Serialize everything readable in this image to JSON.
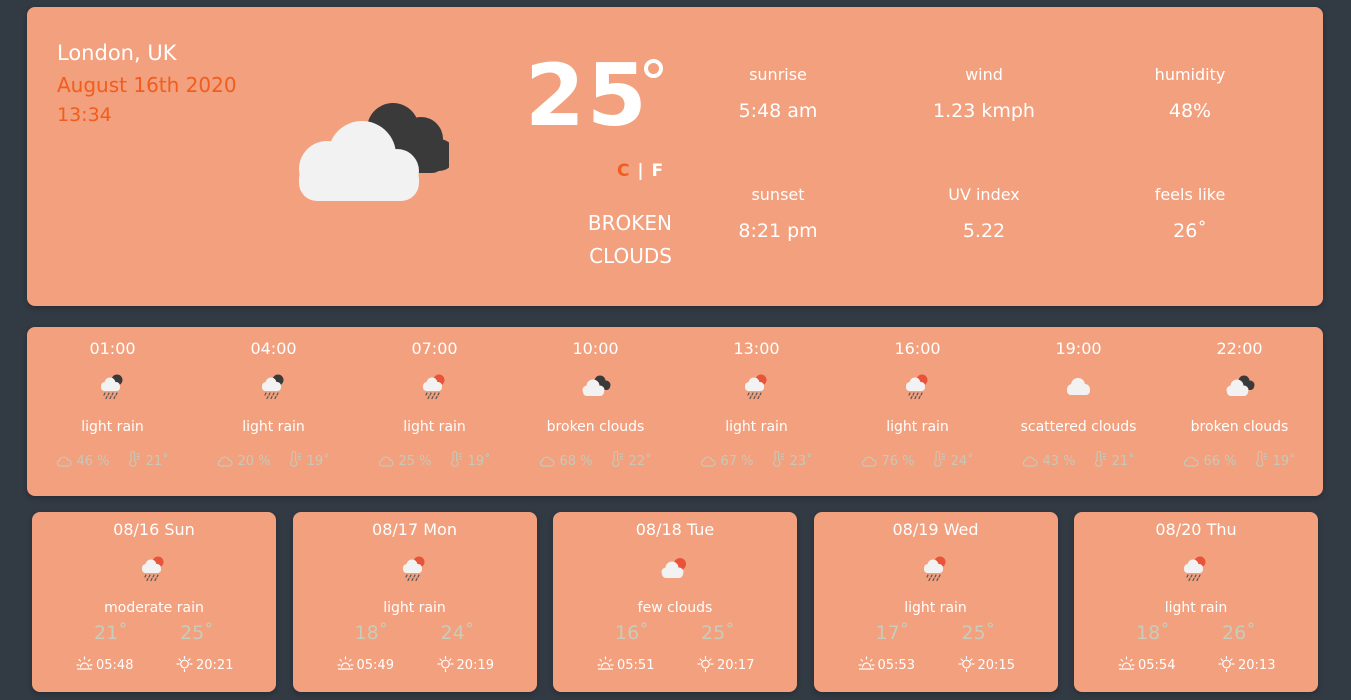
{
  "current": {
    "location": "London, UK",
    "date": "August 16th 2020",
    "time": "13:34",
    "temperature": "25",
    "unit_c": "C",
    "unit_separator": "|",
    "unit_f": "F",
    "description_line1": "broken",
    "description_line2": "clouds",
    "icon": "broken-clouds-icon",
    "stats": {
      "sunrise": {
        "label": "sunrise",
        "value": "5:48 am"
      },
      "wind": {
        "label": "wind",
        "value": "1.23 kmph"
      },
      "humidity": {
        "label": "humidity",
        "value": "48%"
      },
      "sunset": {
        "label": "sunset",
        "value": "8:21 pm"
      },
      "uv": {
        "label": "UV index",
        "value": "5.22"
      },
      "feels_like": {
        "label": "feels like",
        "value": "26˚"
      }
    }
  },
  "hourly": [
    {
      "time": "01:00",
      "icon": "rain-night-icon",
      "desc": "light rain",
      "clouds": "46 %",
      "temp": "21˚"
    },
    {
      "time": "04:00",
      "icon": "rain-night-icon",
      "desc": "light rain",
      "clouds": "20 %",
      "temp": "19˚"
    },
    {
      "time": "07:00",
      "icon": "rain-day-icon",
      "desc": "light rain",
      "clouds": "25 %",
      "temp": "19˚"
    },
    {
      "time": "10:00",
      "icon": "broken-clouds-icon",
      "desc": "broken clouds",
      "clouds": "68 %",
      "temp": "22˚"
    },
    {
      "time": "13:00",
      "icon": "rain-day-icon",
      "desc": "light rain",
      "clouds": "67 %",
      "temp": "23˚"
    },
    {
      "time": "16:00",
      "icon": "rain-day-icon",
      "desc": "light rain",
      "clouds": "76 %",
      "temp": "24˚"
    },
    {
      "time": "19:00",
      "icon": "cloud-icon",
      "desc": "scattered clouds",
      "clouds": "43 %",
      "temp": "21˚"
    },
    {
      "time": "22:00",
      "icon": "broken-clouds-icon",
      "desc": "broken clouds",
      "clouds": "66 %",
      "temp": "19˚"
    }
  ],
  "daily": [
    {
      "date": "08/16 Sun",
      "icon": "rain-day-icon",
      "desc": "moderate rain",
      "min": "21˚",
      "max": "25˚",
      "sunrise": "05:48",
      "sunset": "20:21"
    },
    {
      "date": "08/17 Mon",
      "icon": "rain-day-icon",
      "desc": "light rain",
      "min": "18˚",
      "max": "24˚",
      "sunrise": "05:49",
      "sunset": "20:19"
    },
    {
      "date": "08/18 Tue",
      "icon": "few-clouds-day-icon",
      "desc": "few clouds",
      "min": "16˚",
      "max": "25˚",
      "sunrise": "05:51",
      "sunset": "20:17"
    },
    {
      "date": "08/19 Wed",
      "icon": "rain-day-icon",
      "desc": "light rain",
      "min": "17˚",
      "max": "25˚",
      "sunrise": "05:53",
      "sunset": "20:15"
    },
    {
      "date": "08/20 Thu",
      "icon": "rain-day-icon",
      "desc": "light rain",
      "min": "18˚",
      "max": "26˚",
      "sunrise": "05:54",
      "sunset": "20:13"
    }
  ],
  "colors": {
    "background": "#323a44",
    "card": "#f2a07e",
    "accent": "#f25c1c",
    "muted": "#c6c9b9",
    "cloud_light": "#f2f2f2",
    "cloud_dark": "#3a3a3a",
    "sun": "#e8533a"
  }
}
